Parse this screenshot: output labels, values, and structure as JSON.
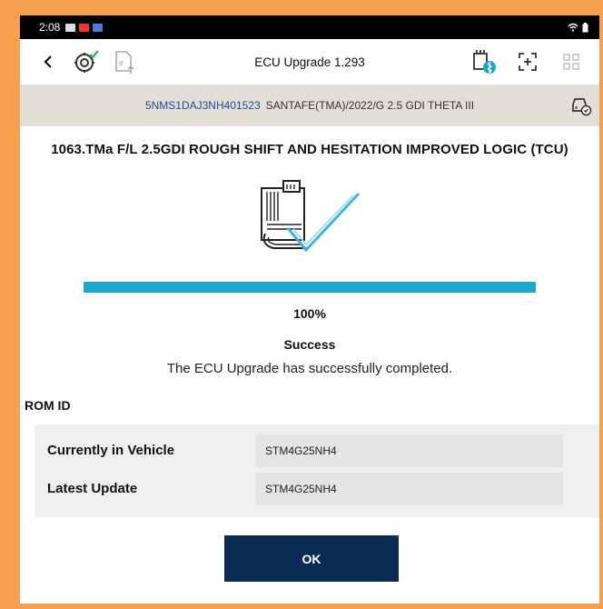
{
  "status_bar": {
    "time": "2:08"
  },
  "toolbar": {
    "title": "ECU Upgrade 1.293"
  },
  "vehicle": {
    "vin": "5NMS1DAJ3NH401523",
    "model": "SANTAFE(TMA)/2022/G 2.5 GDI THETA III"
  },
  "headline": "1063.TMa F/L 2.5GDI ROUGH SHIFT AND HESITATION IMPROVED LOGIC (TCU)",
  "progress": {
    "value": 1.0,
    "label": "100%"
  },
  "result": {
    "title": "Success",
    "message": "The ECU Upgrade has successfully completed."
  },
  "rom": {
    "label": "ROM ID",
    "rows": [
      {
        "key": "Currently in Vehicle",
        "value": "STM4G25NH4"
      },
      {
        "key": "Latest Update",
        "value": "STM4G25NH4"
      }
    ]
  },
  "ok_label": "OK",
  "colors": {
    "frame": "#F6A04D",
    "accent": "#1EA7CD",
    "primary_button": "#0B2B55",
    "vehicle_bar": "#E4DED8"
  },
  "icons": [
    "back-icon",
    "ecu-settings-icon",
    "document-upload-icon",
    "vci-bluetooth-icon",
    "screenshot-icon",
    "grid-menu-icon",
    "vehicle-check-icon",
    "ecu-success-illustration"
  ]
}
